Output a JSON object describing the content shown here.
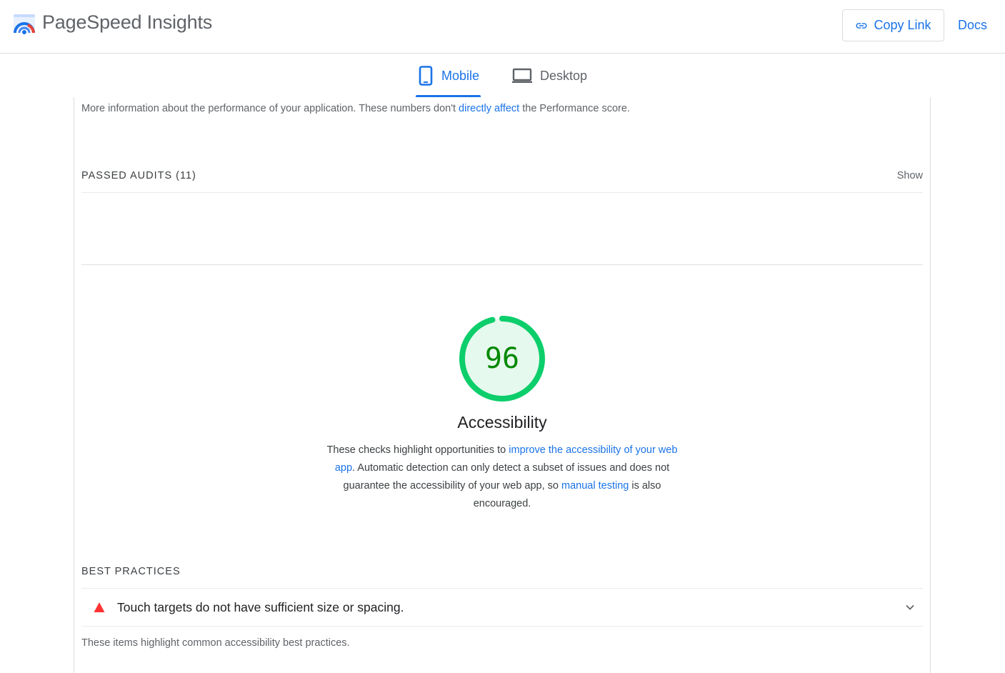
{
  "header": {
    "brand": "PageSpeed Insights",
    "copy_link_label": "Copy Link",
    "docs_label": "Docs"
  },
  "tabs": [
    {
      "label": "Mobile",
      "active": true,
      "icon": "phone-icon"
    },
    {
      "label": "Desktop",
      "active": false,
      "icon": "laptop-icon"
    }
  ],
  "metrics_info": {
    "before": "More information about the performance of your application. These numbers don't ",
    "link": "directly affect",
    "after": " the Performance score."
  },
  "passed_audits": {
    "title": "PASSED AUDITS (11)",
    "show_label": "Show"
  },
  "accessibility": {
    "score": "96",
    "score_fraction": 0.96,
    "title": "Accessibility",
    "desc_1": "These checks highlight opportunities to ",
    "link_1": "improve the accessibility of your web app",
    "desc_2": ". Automatic detection can only detect a subset of issues and does not guarantee the accessibility of your web app, so ",
    "link_2": "manual testing",
    "desc_3": " is also encouraged."
  },
  "best_practices": {
    "title": "BEST PRACTICES",
    "audit": "Touch targets do not have sufficient size or spacing.",
    "desc": "These items highlight common accessibility best practices."
  },
  "colors": {
    "accent": "#1a73e8",
    "pass": "#0cce6b",
    "pass_text": "#008800",
    "fail": "#ff3333"
  }
}
